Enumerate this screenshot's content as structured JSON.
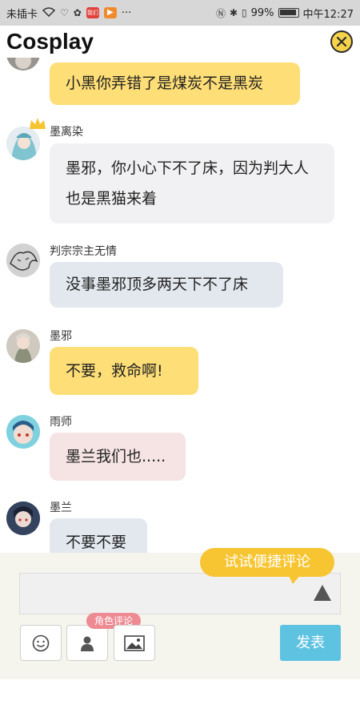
{
  "status_bar": {
    "carrier": "未插卡",
    "battery": "99%",
    "time": "中午12:27",
    "app_badge": "我们",
    "more": "···"
  },
  "header": {
    "title": "Cosplay"
  },
  "messages": [
    {
      "name": "",
      "text": "小黑你弄错了是煤炭不是黑炭",
      "color": "yellow"
    },
    {
      "name": "墨离染",
      "text": "墨邪，你小心下不了床，因为判大人也是黑猫来着",
      "color": "grey"
    },
    {
      "name": "判宗宗主无情",
      "text": "没事墨邪顶多两天下不了床",
      "color": "blue"
    },
    {
      "name": "墨邪",
      "text": "不要，救命啊!",
      "color": "yellow"
    },
    {
      "name": "雨师",
      "text": "墨兰我们也.....",
      "color": "pink"
    },
    {
      "name": "墨兰",
      "text": "不要不要",
      "color": "blue"
    }
  ],
  "input": {
    "tip": "试试便捷评论",
    "role_tag": "角色评论",
    "publish": "发表",
    "value": ""
  },
  "icons": {
    "close": "close-icon",
    "emoji": "emoji-icon",
    "person": "person-icon",
    "image": "image-icon",
    "send": "send-triangle-icon",
    "crown": "crown-icon"
  },
  "colors": {
    "yellow_bubble": "#fede76",
    "grey_bubble": "#f1f1f3",
    "blue_bubble": "#e3e8ef",
    "pink_bubble": "#f6e3e4",
    "tip": "#f7c531",
    "publish": "#5ec3e1",
    "role_tag": "#ee8a92",
    "close": "#f6d34a"
  }
}
